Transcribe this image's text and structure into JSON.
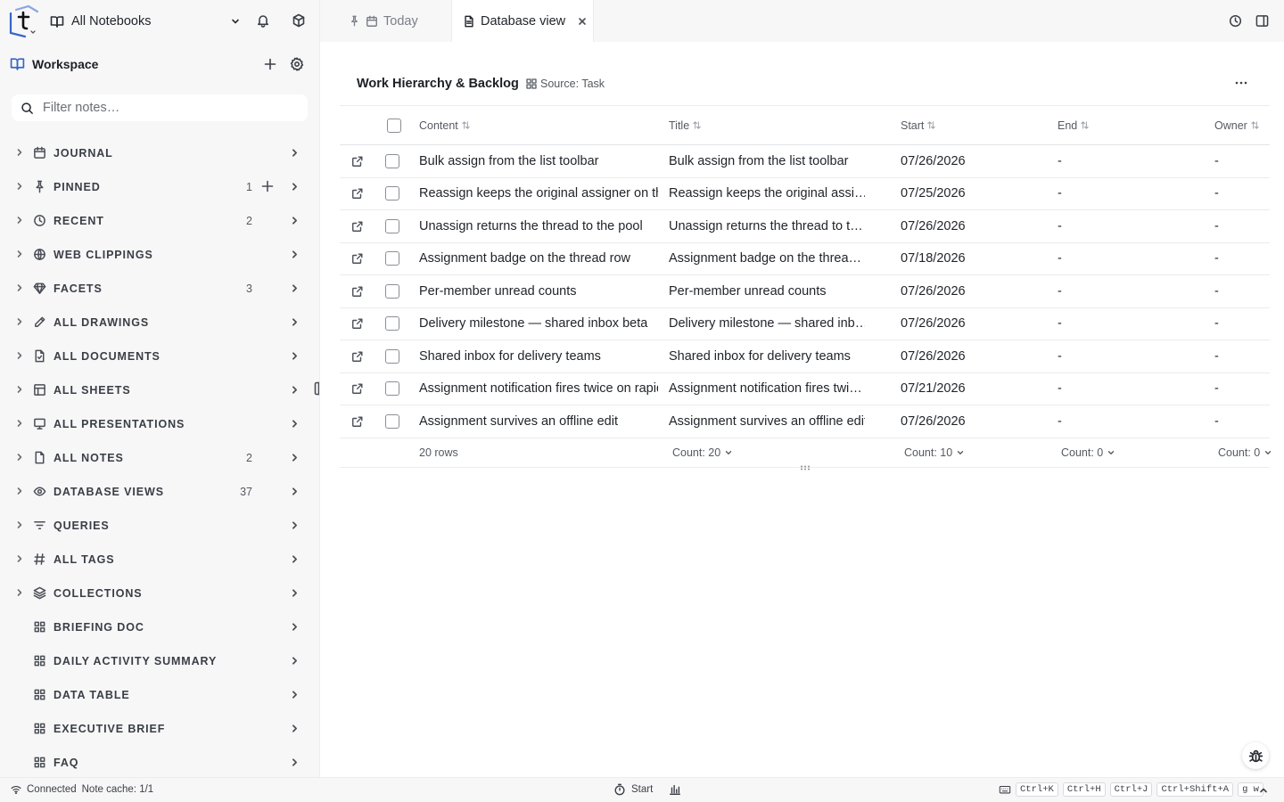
{
  "sidebar": {
    "notebook_label": "All Notebooks",
    "workspace_title": "Workspace",
    "filter_placeholder": "Filter notes…",
    "items": [
      {
        "label": "JOURNAL",
        "icon": "calendar-icon",
        "count": ""
      },
      {
        "label": "PINNED",
        "icon": "pin-icon",
        "count": "1",
        "has_add": true
      },
      {
        "label": "RECENT",
        "icon": "clock-icon",
        "count": "2"
      },
      {
        "label": "WEB CLIPPINGS",
        "icon": "globe-icon",
        "count": ""
      },
      {
        "label": "FACETS",
        "icon": "gem-icon",
        "count": "3"
      },
      {
        "label": "ALL DRAWINGS",
        "icon": "pencil-icon",
        "count": ""
      },
      {
        "label": "ALL DOCUMENTS",
        "icon": "document-icon",
        "count": ""
      },
      {
        "label": "ALL SHEETS",
        "icon": "sheet-icon",
        "count": ""
      },
      {
        "label": "ALL PRESENTATIONS",
        "icon": "presentation-icon",
        "count": ""
      },
      {
        "label": "ALL NOTES",
        "icon": "note-icon",
        "count": "2"
      },
      {
        "label": "DATABASE VIEWS",
        "icon": "eye-icon",
        "count": "37"
      },
      {
        "label": "QUERIES",
        "icon": "filter-icon",
        "count": ""
      },
      {
        "label": "ALL TAGS",
        "icon": "hash-icon",
        "count": ""
      },
      {
        "label": "COLLECTIONS",
        "icon": "layers-icon",
        "count": ""
      },
      {
        "label": "BRIEFING DOC",
        "icon": "grid-icon",
        "count": "",
        "no_expand": true
      },
      {
        "label": "DAILY ACTIVITY SUMMARY",
        "icon": "grid-icon",
        "count": "",
        "no_expand": true
      },
      {
        "label": "DATA TABLE",
        "icon": "grid-icon",
        "count": "",
        "no_expand": true
      },
      {
        "label": "EXECUTIVE BRIEF",
        "icon": "grid-icon",
        "count": "",
        "no_expand": true
      },
      {
        "label": "FAQ",
        "icon": "grid-icon",
        "count": "",
        "no_expand": true
      }
    ]
  },
  "tabs": {
    "today": "Today",
    "database_view": "Database view"
  },
  "database": {
    "title": "Work Hierarchy & Backlog",
    "source": "Source: Task",
    "columns": {
      "content": "Content",
      "title": "Title",
      "start": "Start",
      "end": "End",
      "owner": "Owner"
    },
    "rows": [
      {
        "content": "Bulk assign from the list toolbar",
        "title": "Bulk assign from the list toolbar",
        "start": "07/26/2026",
        "end": "-",
        "owner": "-"
      },
      {
        "content": "Reassign keeps the original assigner on the",
        "title": "Reassign keeps the original assi…",
        "start": "07/25/2026",
        "end": "-",
        "owner": "-"
      },
      {
        "content": "Unassign returns the thread to the pool",
        "title": "Unassign returns the thread to t…",
        "start": "07/26/2026",
        "end": "-",
        "owner": "-"
      },
      {
        "content": "Assignment badge on the thread row",
        "title": "Assignment badge on the threa…",
        "start": "07/18/2026",
        "end": "-",
        "owner": "-"
      },
      {
        "content": "Per-member unread counts",
        "title": "Per-member unread counts",
        "start": "07/26/2026",
        "end": "-",
        "owner": "-"
      },
      {
        "content": "Delivery milestone — shared inbox beta",
        "title": "Delivery milestone — shared inb…",
        "start": "07/26/2026",
        "end": "-",
        "owner": "-"
      },
      {
        "content": "Shared inbox for delivery teams",
        "title": "Shared inbox for delivery teams",
        "start": "07/26/2026",
        "end": "-",
        "owner": "-"
      },
      {
        "content": "Assignment notification fires twice on rapid",
        "title": "Assignment notification fires twi…",
        "start": "07/21/2026",
        "end": "-",
        "owner": "-"
      },
      {
        "content": "Assignment survives an offline edit",
        "title": "Assignment survives an offline edit",
        "start": "07/26/2026",
        "end": "-",
        "owner": "-"
      }
    ],
    "footer": {
      "rows": "20 rows",
      "title_count": "Count: 20",
      "start_count": "Count: 10",
      "end_count": "Count: 0",
      "owner_count": "Count: 0"
    }
  },
  "status": {
    "connected": "Connected",
    "cache": "Note cache: 1/1",
    "start": "Start",
    "shortcuts": [
      "Ctrl+K",
      "Ctrl+H",
      "Ctrl+J",
      "Ctrl+Shift+A",
      "g w"
    ]
  },
  "colors": {
    "accent": "#3566c9",
    "sidebar_bg": "#f7f7f8",
    "border": "#ececee"
  }
}
